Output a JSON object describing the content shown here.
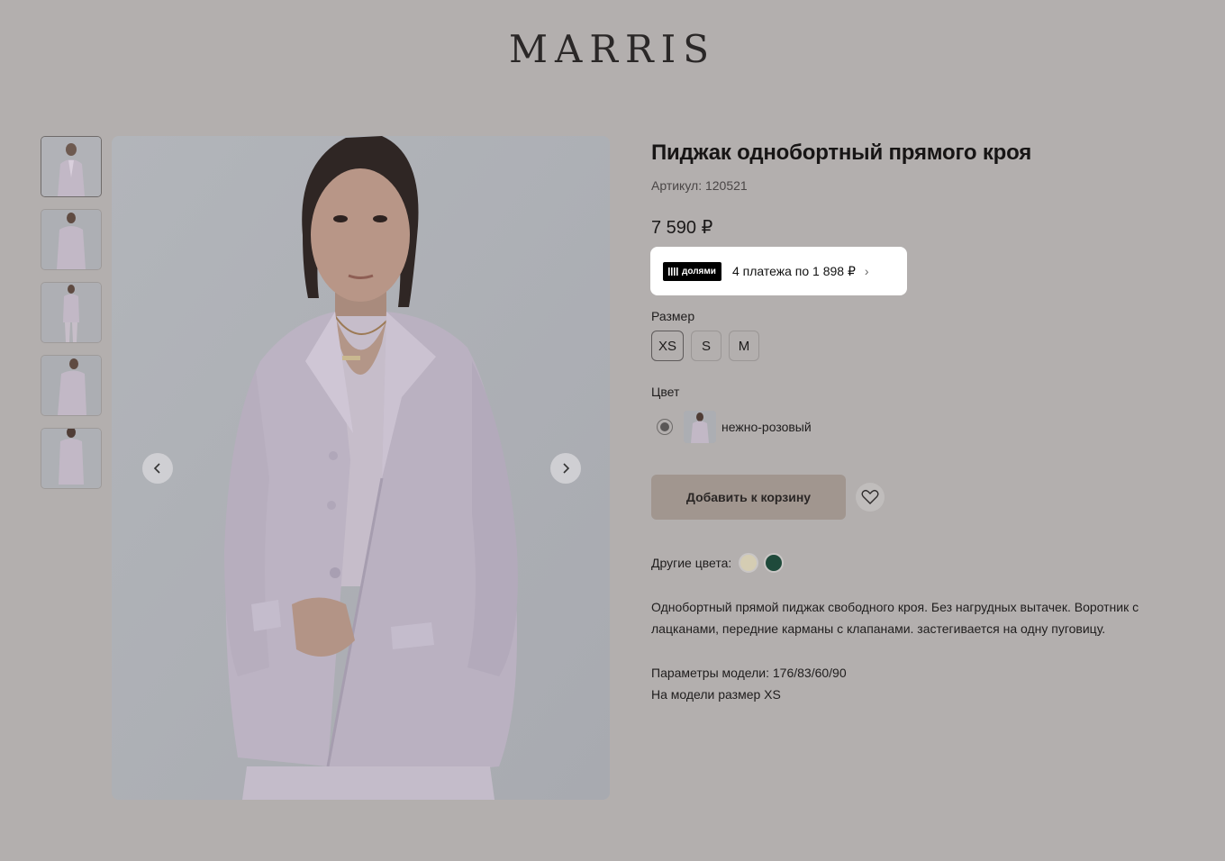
{
  "brand": {
    "logo": "MARRIS"
  },
  "gallery": {
    "thumbnail_count": 5,
    "prev_icon": "chevron-left-icon",
    "next_icon": "chevron-right-icon"
  },
  "product": {
    "title": "Пиджак однобортный прямого кроя",
    "sku": "Артикул: 120521",
    "price": "7 590 ₽",
    "dolyami": {
      "badge": "долями",
      "text": "4 платежа по 1 898 ₽",
      "chevron": "›"
    },
    "size_label": "Размер",
    "sizes": [
      "XS",
      "S",
      "M"
    ],
    "selected_size": "XS",
    "color_label": "Цвет",
    "color_name": "нежно-розовый",
    "add_to_cart": "Добавить к корзину",
    "favorite_icon": "heart-icon",
    "other_colors_label": "Другие цвета:",
    "other_colors": [
      "#d5cdb3",
      "#1f4a3b"
    ],
    "description": "Однобортный прямой пиджак свободного кроя. Без нагрудных вытачек. Воротник с лацканами, передние карманы с клапанами. застегивается на одну пуговицу.",
    "model_params": "Параметры модели: 176/83/60/90",
    "model_size": "На модели размер XS"
  },
  "colors": {
    "page_bg": "#b3afae",
    "button_bg": "#a1968f",
    "jacket": "#bcb3c3"
  }
}
